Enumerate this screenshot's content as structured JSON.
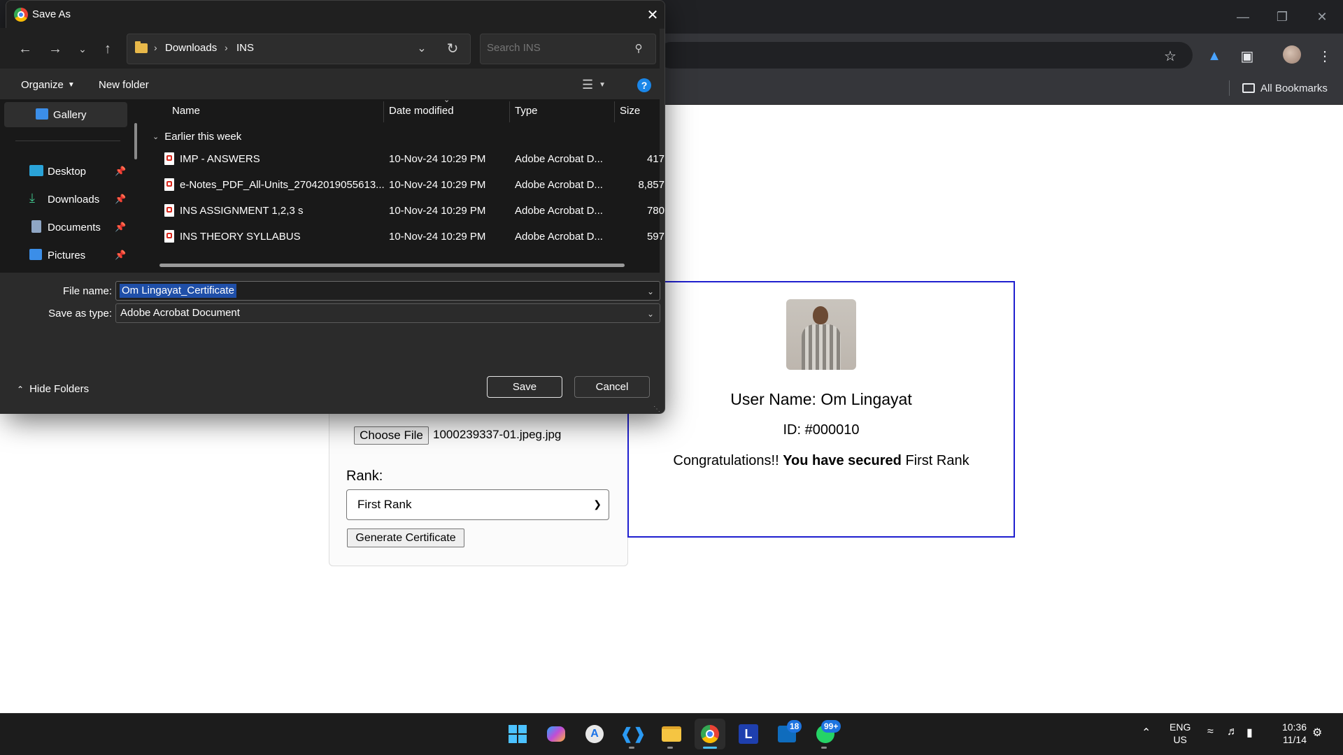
{
  "dialog": {
    "title": "Save As",
    "breadcrumb": [
      "Downloads",
      "INS"
    ],
    "search_placeholder": "Search INS",
    "toolbar": {
      "organize": "Organize",
      "new_folder": "New folder"
    },
    "nav": [
      {
        "label": "Gallery",
        "icon": "gallery-icon"
      },
      {
        "label": "Desktop",
        "icon": "desktop-icon",
        "pinned": true
      },
      {
        "label": "Downloads",
        "icon": "download-icon",
        "pinned": true
      },
      {
        "label": "Documents",
        "icon": "documents-icon",
        "pinned": true
      },
      {
        "label": "Pictures",
        "icon": "pictures-icon",
        "pinned": true
      }
    ],
    "columns": [
      "Name",
      "Date modified",
      "Type",
      "Size"
    ],
    "group": "Earlier this week",
    "files": [
      {
        "name": "IMP - ANSWERS",
        "date": "10-Nov-24 10:29 PM",
        "type": "Adobe Acrobat D...",
        "size": "417"
      },
      {
        "name": "e-Notes_PDF_All-Units_27042019055613...",
        "date": "10-Nov-24 10:29 PM",
        "type": "Adobe Acrobat D...",
        "size": "8,857"
      },
      {
        "name": "INS ASSIGNMENT 1,2,3 s",
        "date": "10-Nov-24 10:29 PM",
        "type": "Adobe Acrobat D...",
        "size": "780"
      },
      {
        "name": "INS THEORY SYLLABUS",
        "date": "10-Nov-24 10:29 PM",
        "type": "Adobe Acrobat D...",
        "size": "597"
      }
    ],
    "file_name_label": "File name:",
    "file_name_value": "Om Lingayat_Certificate",
    "save_type_label": "Save as type:",
    "save_type_value": "Adobe Acrobat Document",
    "hide_folders": "Hide Folders",
    "save_button": "Save",
    "cancel_button": "Cancel"
  },
  "browser": {
    "bookmarks_label": "All Bookmarks"
  },
  "page": {
    "choose_file_label": "Choose File",
    "chosen_file": "1000239337-01.jpeg.jpg",
    "rank_label": "Rank:",
    "rank_value": "First Rank",
    "generate_button": "Generate Certificate",
    "certificate": {
      "username": "User Name: Om Lingayat",
      "id": "ID: #000010",
      "congrats_prefix": "Congratulations!!",
      "congrats_bold": "You have secured",
      "congrats_rank": "First Rank",
      "border_color": "#1f1fcf"
    }
  },
  "taskbar": {
    "apps": [
      "windows-start-icon",
      "copilot-icon",
      "app-store-icon",
      "vscode-icon",
      "file-explorer-icon",
      "chrome-icon",
      "l-app-icon",
      "outlook-icon",
      "whatsapp-icon"
    ],
    "outlook_badge": "18",
    "whatsapp_badge": "99+",
    "lang_line1": "ENG",
    "lang_line2": "US",
    "time": "10:36",
    "date": "11/14"
  }
}
